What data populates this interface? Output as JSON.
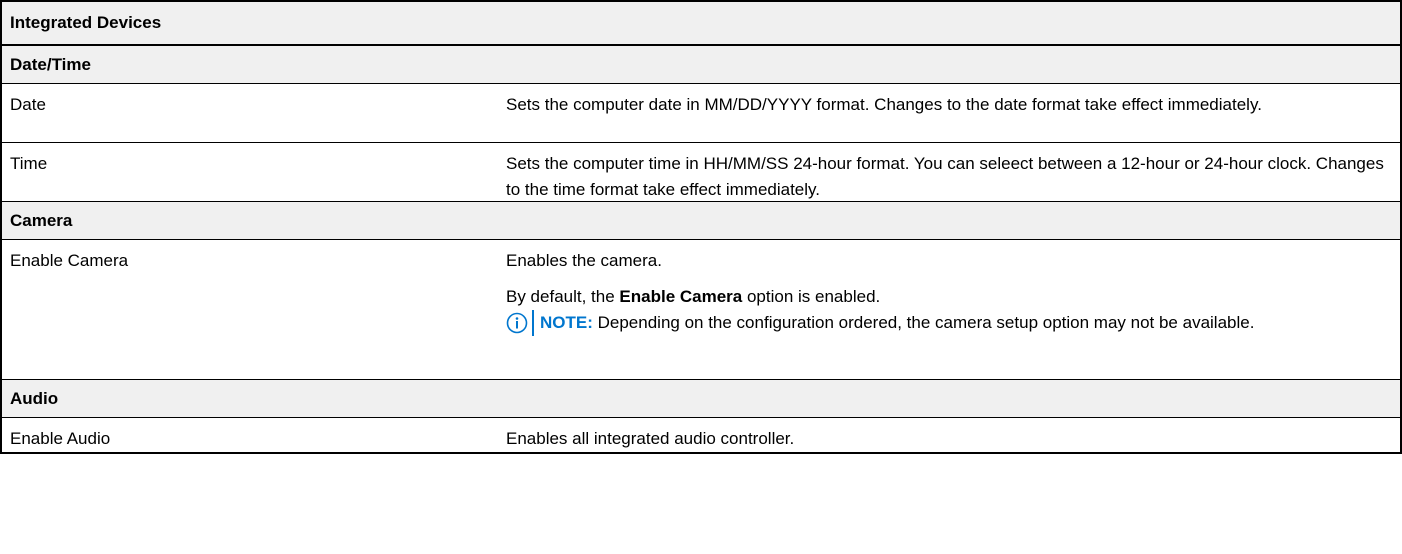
{
  "table": {
    "title": "Integrated Devices",
    "sections": [
      {
        "heading": "Date/Time",
        "rows": [
          {
            "option": "Date",
            "description": "Sets the computer date in MM/DD/YYYY format. Changes to the date format take effect immediately."
          },
          {
            "option": "Time",
            "description": "Sets the computer time in HH/MM/SS 24-hour format. You can seleect between a 12-hour or 24-hour clock. Changes to the time format take effect immediately."
          }
        ]
      },
      {
        "heading": "Camera",
        "rows": [
          {
            "option": "Enable Camera",
            "description": "Enables the camera.",
            "default_prefix": "By default, the ",
            "default_bold": "Enable Camera",
            "default_suffix": " option is enabled.",
            "note_label": "NOTE:",
            "note_text": " Depending on the configuration ordered, the camera setup option may not be available."
          }
        ]
      },
      {
        "heading": "Audio",
        "rows": [
          {
            "option": "Enable Audio",
            "description": "Enables all integrated audio controller."
          }
        ]
      }
    ]
  },
  "icons": {
    "note": "info-icon"
  },
  "colors": {
    "note_accent": "#0076CE",
    "header_bg": "#f0f0f0"
  }
}
